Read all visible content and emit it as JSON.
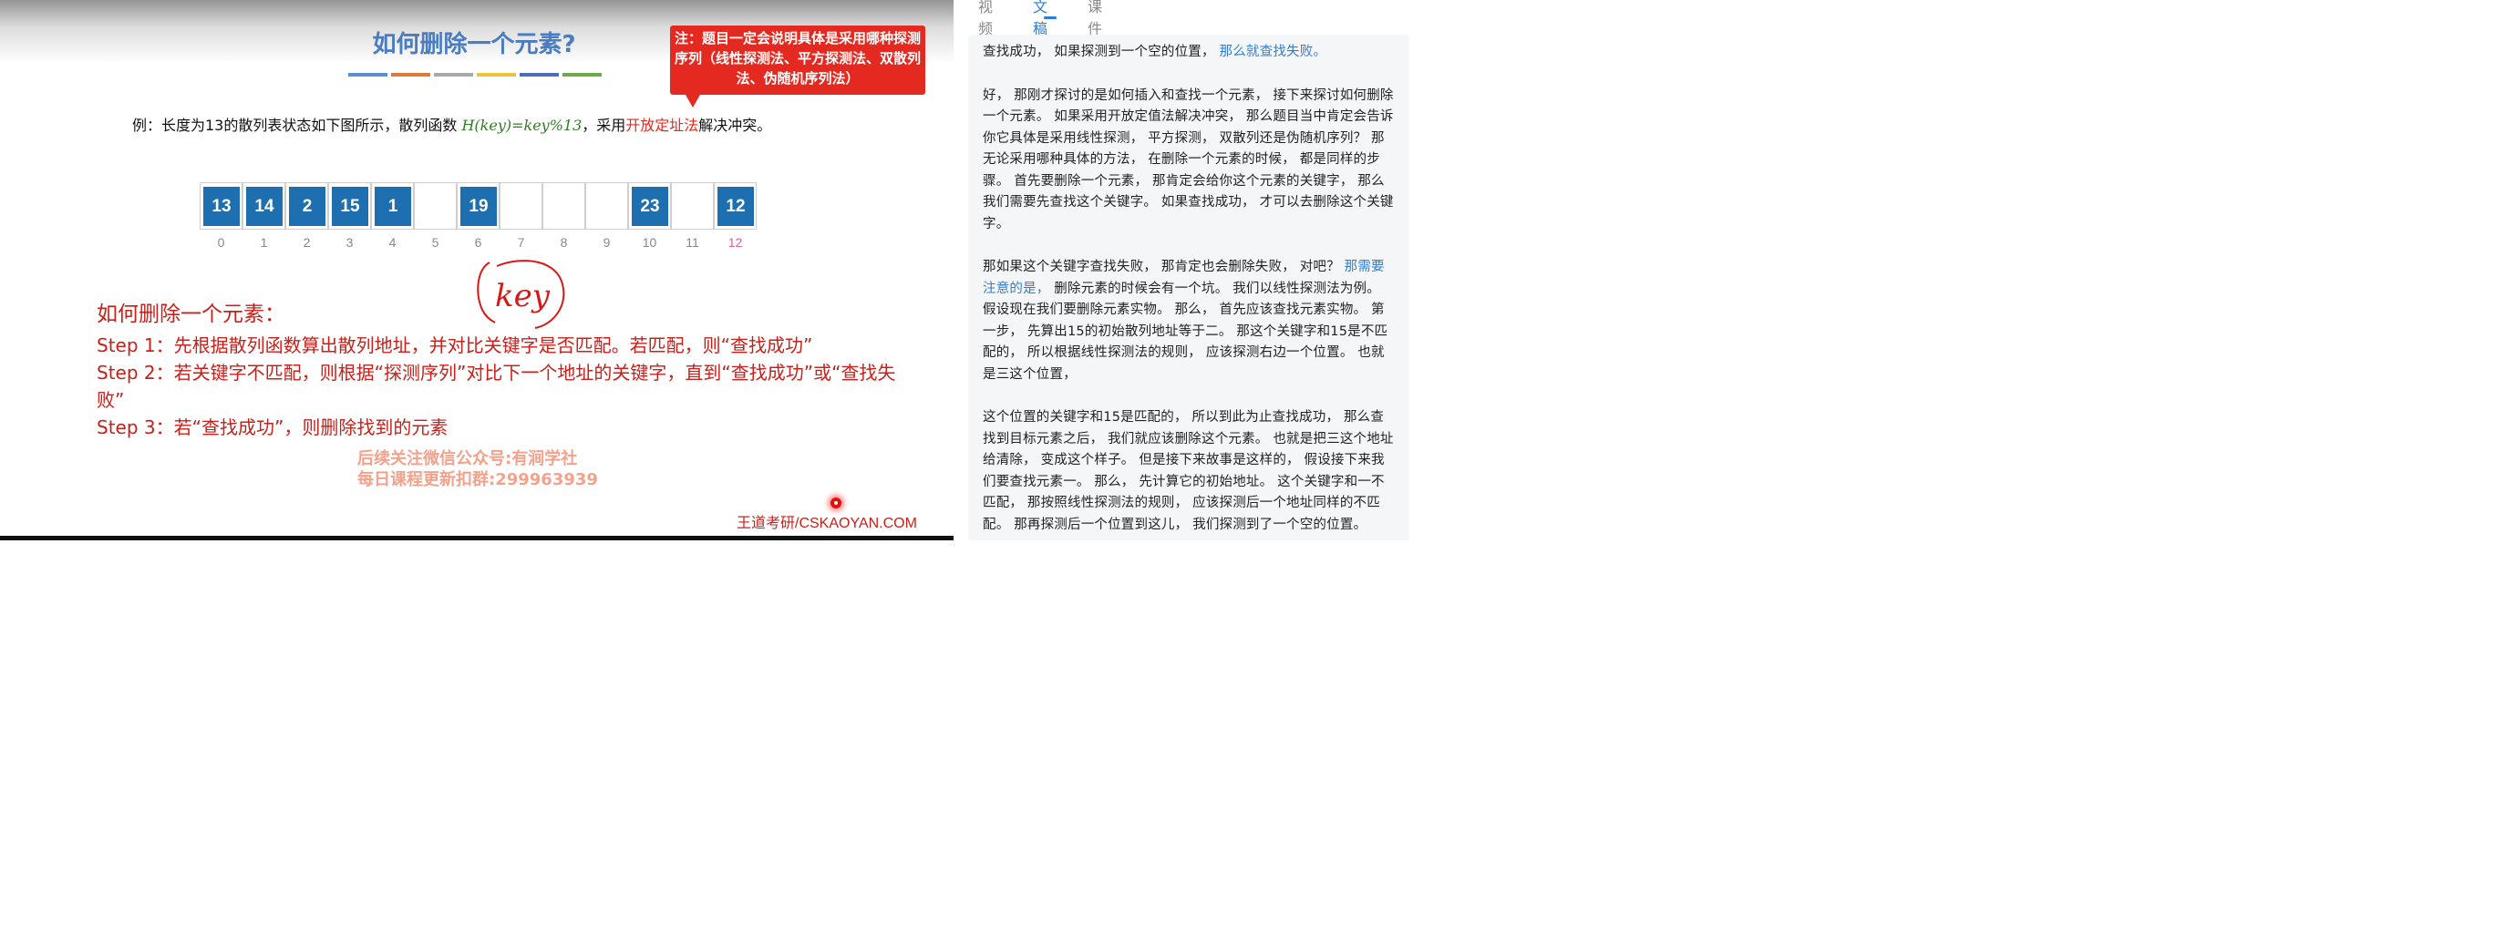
{
  "slide": {
    "title": "如何删除一个元素?",
    "underline_colors": [
      "#5b8fd0",
      "#e0793a",
      "#a8a8a8",
      "#f0c23a",
      "#4a6fb8",
      "#6aaa4a"
    ],
    "note": "注：题目一定会说明具体是采用哪种探测序列（线性探测法、平方探测法、双散列法、伪随机序列法）",
    "example": {
      "prefix": "例：长度为13的散列表状态如下图所示，散列函数 ",
      "formula": "H(key)=key%13",
      "middle": "，采用",
      "method": "开放定址法",
      "suffix": "解决冲突。"
    },
    "hash_table": {
      "cells": [
        "13",
        "14",
        "2",
        "15",
        "1",
        "",
        "19",
        "",
        "",
        "",
        "23",
        "",
        "12"
      ],
      "indices": [
        "0",
        "1",
        "2",
        "3",
        "4",
        "5",
        "6",
        "7",
        "8",
        "9",
        "10",
        "11",
        "12"
      ]
    },
    "scribble_text": "key",
    "steps_heading": "如何删除一个元素：",
    "steps": [
      "Step 1：先根据散列函数算出散列地址，并对比关键字是否匹配。若匹配，则“查找成功”",
      "Step 2：若关键字不匹配，则根据“探测序列”对比下一个地址的关键字，直到“查找成功”或“查找失败”",
      "Step 3：若“查找成功”，则删除找到的元素"
    ],
    "watermark_line1": "后续关注微信公众号:有涧学社",
    "watermark_line2": "每日课程更新扣群:299963939",
    "brand": "王道考研/CSKAOYAN.COM",
    "accent_blue": "#1d6fb0",
    "accent_red": "#e42a20"
  },
  "tabs": [
    {
      "label": "视频",
      "active": false
    },
    {
      "label": "文稿",
      "active": true
    },
    {
      "label": "课件",
      "active": false
    }
  ],
  "transcript": [
    [
      {
        "t": "查找成功， 如果探测到一个空的位置， "
      },
      {
        "t": "那么就查找失败。",
        "hl": true
      }
    ],
    [
      {
        "t": "好， 那刚才探讨的是如何插入和查找一个元素， 接下来探讨如何删除一个元素。 如果采用开放定值法解决冲突， 那么题目当中肯定会告诉你它具体是采用线性探测， 平方探测， 双散列还是伪随机序列？ 那无论采用哪种具体的方法， 在删除一个元素的时候， 都是同样的步骤。 首先要删除一个元素， 那肯定会给你这个元素的关键字， 那么我们需要先查找这个关键字。 如果查找成功， 才可以去删除这个关键字。"
      }
    ],
    [
      {
        "t": "那如果这个关键字查找失败， 那肯定也会删除失败， 对吧？ "
      },
      {
        "t": "那需要注意的是，",
        "hl": true
      },
      {
        "t": " 删除元素的时候会有一个坑。 我们以线性探测法为例。 假设现在我们要删除元素实物。 那么， 首先应该查找元素实物。 第一步， 先算出15的初始散列地址等于二。 那这个关键字和15是不匹配的， 所以根据线性探测法的规则， 应该探测右边一个位置。 也就是三这个位置，"
      }
    ],
    [
      {
        "t": "这个位置的关键字和15是匹配的， 所以到此为止查找成功， 那么查找到目标元素之后， 我们就应该删除这个元素。 也就是把三这个地址给清除， 变成这个样子。 但是接下来故事是这样的， 假设接下来我们要查找元素一。 那么， 先计算它的初始地址。 这个关键字和一不匹配， 那按照线性探测法的规则， 应该探测后一个地址同样的不匹配。 那再探测后一个位置到这儿， 我们探测到了一个空的位置。"
      }
    ]
  ],
  "colors": {
    "tab_active": "#2b7fd9",
    "tab_inactive": "#8a8a8a",
    "transcript_highlight": "#2b7fd9",
    "index_highlight": "#e060a0"
  }
}
